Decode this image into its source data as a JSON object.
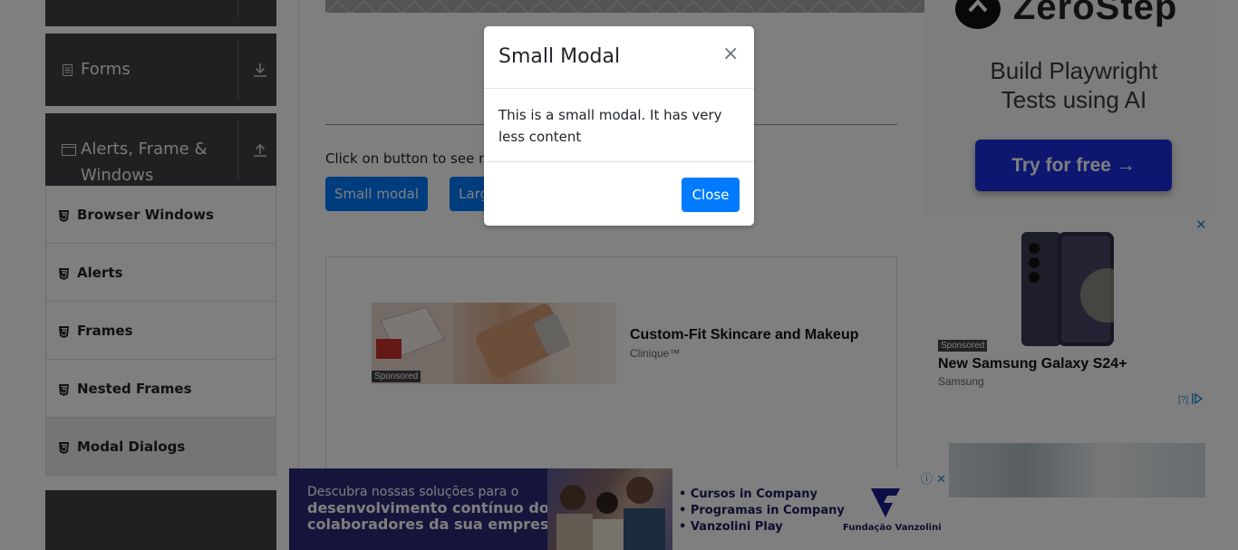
{
  "sidebar": {
    "groups": [
      {
        "label": "",
        "icon": "none"
      },
      {
        "label": "Forms",
        "icon": "form-icon"
      },
      {
        "label": "Alerts, Frame & Windows",
        "line1": "Alerts, Frame &",
        "line2": "Windows",
        "icon": "window-icon"
      }
    ],
    "items": [
      {
        "label": "Browser Windows",
        "icon": "html5-icon"
      },
      {
        "label": "Alerts",
        "icon": "html5-icon"
      },
      {
        "label": "Frames",
        "icon": "html5-icon"
      },
      {
        "label": "Nested Frames",
        "icon": "html5-icon"
      },
      {
        "label": "Modal Dialogs",
        "icon": "html5-icon",
        "active": true
      }
    ]
  },
  "main": {
    "instruction": "Click on button to see modal",
    "small_button": "Small modal",
    "large_button": "Large modal"
  },
  "ad_skincare": {
    "title": "Custom-Fit Skincare and Makeup",
    "source": "Clinique™",
    "sponsored": "Sponsored"
  },
  "ad_zerostep": {
    "brand": "ZeroStep",
    "headline_line1": "Build Playwright",
    "headline_line2": "Tests using AI",
    "cta": "Try for free →"
  },
  "ad_samsung": {
    "sponsored": "Sponsored",
    "title": "New Samsung Galaxy S24+",
    "source": "Samsung",
    "adchoices": "[?]",
    "close": "✕"
  },
  "ad_bottom": {
    "line1": "Descubra nossas soluções para o",
    "line2": "desenvolvimento contínuo dos",
    "line3": "colaboradores da sua empresa",
    "list": [
      "• Cursos in Company",
      "• Programas in Company",
      "• Vanzolini Play"
    ],
    "brand": "Fundação Vanzolini",
    "close": "ⓘ ✕"
  },
  "modal": {
    "title": "Small Modal",
    "close_glyph": "×",
    "body": "This is a small modal. It has very less content",
    "close_button": "Close"
  },
  "colors": {
    "primary": "#007bff",
    "sidebar_header": "#3f4145",
    "zerostep_cta": "#1b2fe0",
    "vanzolini_navy": "#2b2a78"
  }
}
